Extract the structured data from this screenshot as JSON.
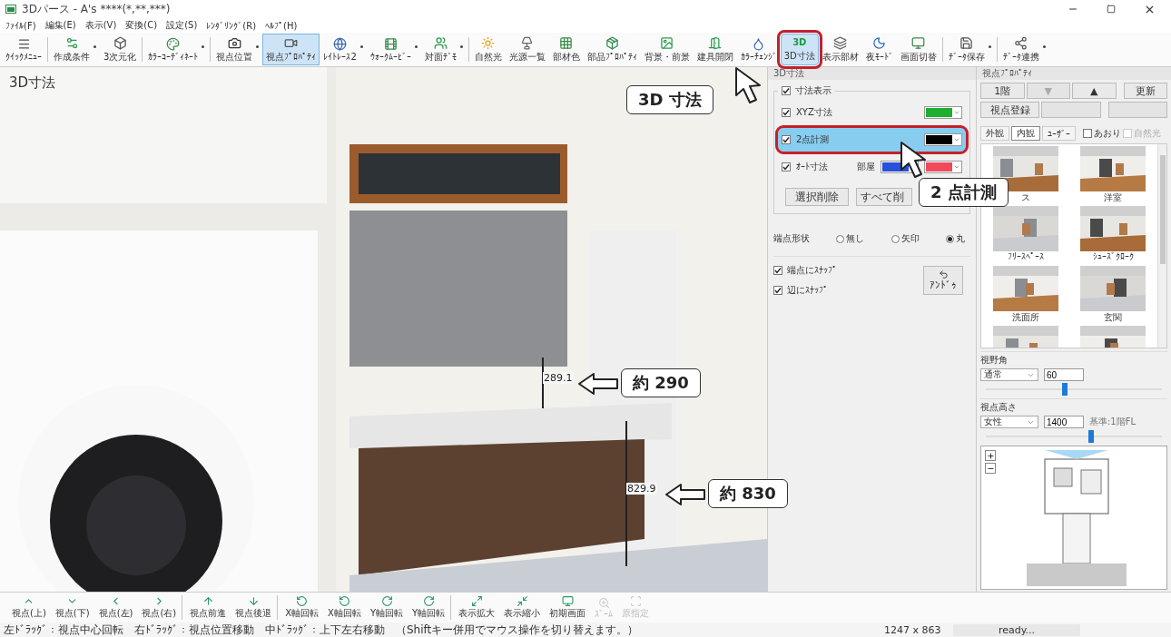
{
  "window": {
    "title": "3Dパース - A's ****(*,**,***)"
  },
  "menu": [
    "ﾌｧｲﾙ(F)",
    "編集(E)",
    "表示(V)",
    "変換(C)",
    "設定(S)",
    "ﾚﾝﾀﾞﾘﾝｸﾞ(R)",
    "ﾍﾙﾌﾟ(H)"
  ],
  "toolbar": [
    {
      "label": "ｸｲｯｸﾒﾆｭｰ",
      "selected": false,
      "dropdown": false,
      "group_start": false,
      "highlighted": false
    },
    {
      "label": "作成条件",
      "selected": false,
      "dropdown": true,
      "group_start": true,
      "highlighted": false
    },
    {
      "label": "3次元化",
      "selected": false,
      "dropdown": false,
      "group_start": false,
      "highlighted": false
    },
    {
      "label": "ｶﾗｰｺｰﾃﾞｨﾈｰﾄ",
      "selected": false,
      "dropdown": true,
      "group_start": true,
      "highlighted": false
    },
    {
      "label": "視点位置",
      "selected": false,
      "dropdown": true,
      "group_start": true,
      "highlighted": false
    },
    {
      "label": "視点ﾌﾟﾛﾊﾟﾃｨ",
      "selected": true,
      "dropdown": false,
      "group_start": false,
      "highlighted": false
    },
    {
      "label": "ﾚｲﾄﾚｰｽ2",
      "selected": false,
      "dropdown": true,
      "group_start": false,
      "highlighted": false
    },
    {
      "label": "ｳｫｰｸﾑｰﾋﾞｰ",
      "selected": false,
      "dropdown": true,
      "group_start": false,
      "highlighted": false
    },
    {
      "label": "対面ﾃﾞﾓ",
      "selected": false,
      "dropdown": true,
      "group_start": false,
      "highlighted": false
    },
    {
      "label": "自然光",
      "selected": false,
      "dropdown": false,
      "group_start": true,
      "highlighted": false
    },
    {
      "label": "光源一覧",
      "selected": false,
      "dropdown": false,
      "group_start": false,
      "highlighted": false
    },
    {
      "label": "部材色",
      "selected": false,
      "dropdown": false,
      "group_start": false,
      "highlighted": false
    },
    {
      "label": "部品ﾌﾟﾛﾊﾟﾃｨ",
      "selected": false,
      "dropdown": false,
      "group_start": false,
      "highlighted": false
    },
    {
      "label": "背景・前景",
      "selected": false,
      "dropdown": false,
      "group_start": false,
      "highlighted": false
    },
    {
      "label": "建具開閉",
      "selected": false,
      "dropdown": false,
      "group_start": false,
      "highlighted": false
    },
    {
      "label": "ｶﾗｰﾁｪﾝｼﾞ",
      "selected": false,
      "dropdown": false,
      "group_start": false,
      "highlighted": false
    },
    {
      "label": "3D寸法",
      "icon_text": "3D",
      "selected": true,
      "dropdown": false,
      "group_start": false,
      "highlighted": true
    },
    {
      "label": "表示部材",
      "selected": false,
      "dropdown": false,
      "group_start": false,
      "highlighted": false
    },
    {
      "label": "夜ﾓｰﾄﾞ",
      "selected": false,
      "dropdown": false,
      "group_start": false,
      "highlighted": false
    },
    {
      "label": "画面切替",
      "selected": false,
      "dropdown": false,
      "group_start": false,
      "highlighted": false
    },
    {
      "label": "ﾃﾞｰﾀ保存",
      "selected": false,
      "dropdown": true,
      "group_start": true,
      "highlighted": false
    },
    {
      "label": "ﾃﾞｰﾀ連携",
      "selected": false,
      "dropdown": true,
      "group_start": true,
      "highlighted": false
    }
  ],
  "viewport": {
    "label": "3D寸法",
    "measurements": [
      {
        "value": "289.1"
      },
      {
        "value": "829.9"
      }
    ]
  },
  "dimension_panel": {
    "title": "3D寸法",
    "show_dimensions": {
      "label": "寸法表示",
      "checked": true
    },
    "rows": [
      {
        "kind": "single",
        "label": "XYZ寸法",
        "checked": true,
        "selected": false,
        "highlighted": false,
        "swatches": [
          {
            "color": "#1fae2e"
          }
        ]
      },
      {
        "kind": "single",
        "label": "2点計測",
        "checked": true,
        "selected": true,
        "highlighted": true,
        "swatches": [
          {
            "color": "#000000"
          }
        ]
      },
      {
        "kind": "double",
        "label": "ｵｰﾄ寸法",
        "checked": true,
        "selected": false,
        "highlighted": false,
        "sub_label": "部屋",
        "swatches": [
          {
            "color": "#2850d8"
          },
          {
            "color": "#f04a5a"
          }
        ]
      }
    ],
    "buttons": [
      "選択削除",
      "すべて削"
    ],
    "endpoint": {
      "label": "端点形状",
      "options": [
        {
          "label": "無し",
          "selected": false
        },
        {
          "label": "矢印",
          "selected": false
        },
        {
          "label": "丸",
          "selected": true
        }
      ]
    },
    "snaps": [
      {
        "label": "端点にｽﾅｯﾌﾟ",
        "checked": true
      },
      {
        "label": "辺にｽﾅｯﾌﾟ",
        "checked": true
      }
    ],
    "undo": "ｱﾝﾄﾞｩ"
  },
  "view_panel": {
    "title": "視点ﾌﾟﾛﾊﾟﾃｨ",
    "floor_buttons": [
      {
        "label": "1階",
        "disabled": false
      },
      {
        "label": "▼",
        "disabled": true
      },
      {
        "label": "▲",
        "disabled": false
      },
      {
        "label": "更新",
        "disabled": false
      }
    ],
    "register_button": "視点登録",
    "tabs": [
      {
        "label": "外観",
        "selected": false
      },
      {
        "label": "内観",
        "selected": true
      },
      {
        "label": "ﾕｰｻﾞｰ",
        "selected": false
      }
    ],
    "options": [
      {
        "label": "あおり",
        "checked": false,
        "disabled": false
      },
      {
        "label": "自然光",
        "checked": false,
        "disabled": true
      }
    ],
    "thumbnails": [
      {
        "kind": "labeled",
        "label": "ス"
      },
      {
        "kind": "labeled",
        "label": "洋室"
      },
      {
        "kind": "labeled",
        "label": "ﾌﾘｰｽﾍﾟｰｽ"
      },
      {
        "kind": "labeled",
        "label": "ｼｭｰｽﾞｸﾛｰｸ"
      },
      {
        "kind": "labeled",
        "label": "洗面所"
      },
      {
        "kind": "labeled",
        "label": "玄関"
      },
      {
        "kind": "picture"
      },
      {
        "kind": "picture"
      }
    ],
    "fov": {
      "label": "視野角",
      "mode": "通常",
      "value": "60",
      "level": 0.45
    },
    "eye_height": {
      "label": "視点高さ",
      "mode": "女性",
      "value": "1400",
      "note": "基準:1階FL",
      "level": 0.6
    }
  },
  "bottom_toolbar": [
    {
      "label": "視点(上)",
      "disabled": false,
      "group_start": false
    },
    {
      "label": "視点(下)",
      "disabled": false,
      "group_start": false
    },
    {
      "label": "視点(左)",
      "disabled": false,
      "group_start": false
    },
    {
      "label": "視点(右)",
      "disabled": false,
      "group_start": false
    },
    {
      "label": "視点前進",
      "disabled": false,
      "group_start": true
    },
    {
      "label": "視点後退",
      "disabled": false,
      "group_start": false
    },
    {
      "label": "X軸回転",
      "disabled": false,
      "group_start": true
    },
    {
      "label": "X軸回転",
      "disabled": false,
      "group_start": false
    },
    {
      "label": "Y軸回転",
      "disabled": false,
      "group_start": false
    },
    {
      "label": "Y軸回転",
      "disabled": false,
      "group_start": false
    },
    {
      "label": "表示拡大",
      "disabled": false,
      "group_start": true
    },
    {
      "label": "表示縮小",
      "disabled": false,
      "group_start": false
    },
    {
      "label": "初期画面",
      "disabled": false,
      "group_start": false
    },
    {
      "label": "ｽﾞｰﾑ",
      "disabled": true,
      "group_start": false
    },
    {
      "label": "原指定",
      "disabled": true,
      "group_start": false
    }
  ],
  "status_bar": {
    "hint": "左ﾄﾞﾗｯｸﾞ：視点中心回転　右ﾄﾞﾗｯｸﾞ：視点位置移動　中ﾄﾞﾗｯｸﾞ：上下左右移動　（Shiftキー併用でマウス操作を切り替えます。）",
    "size": "1247 x 863",
    "state": "ready..."
  },
  "callouts": [
    {
      "kind": "pointer",
      "text": "3D 寸法"
    },
    {
      "kind": "pointer",
      "text": "2 点計測"
    },
    {
      "kind": "arrow",
      "text": "約 290"
    },
    {
      "kind": "arrow",
      "text": "約 830"
    }
  ]
}
